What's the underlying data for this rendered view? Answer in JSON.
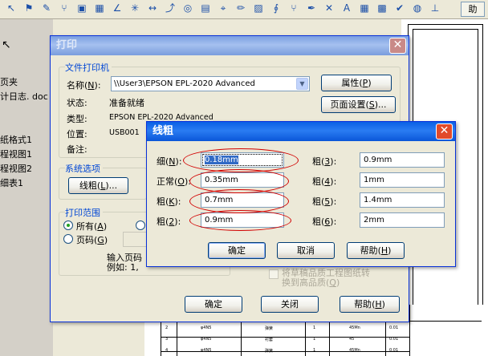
{
  "toolbar": {
    "icons": [
      "arrow-icon",
      "flag-icon",
      "note-icon",
      "fork-icon",
      "box-icon",
      "grid-icon",
      "angle-icon",
      "star-icon",
      "dimension-icon",
      "bend-icon",
      "target-icon",
      "stack-icon",
      "cursor-icon",
      "pencil-icon",
      "hatch-icon",
      "symbol-icon",
      "fork-icon",
      "pen-icon",
      "cross-icon",
      "letter-icon",
      "grid-icon",
      "cell-icon",
      "check-icon",
      "cylinder-icon",
      "pin-icon"
    ],
    "help_label": "助"
  },
  "left_panel": {
    "items": [
      "页夹",
      "计日志. doc",
      "纸格式1",
      "程视图1",
      "程视图2",
      "细表1"
    ]
  },
  "print_dialog": {
    "title": "打印",
    "printer_group": "文件打印机",
    "name_label": "名称",
    "name_key": "N",
    "printer_name": "\\\\User3\\EPSON EPL-2020 Advanced",
    "properties_button": "属性",
    "properties_key": "P",
    "page_setup_button": "页面设置",
    "page_setup_key": "S",
    "status_label": "状态:",
    "status_value": "准备就绪",
    "type_label": "类型:",
    "type_value": "EPSON EPL-2020 Advanced",
    "location_label": "位置:",
    "location_value": "USB001",
    "comment_label": "备注:",
    "system_options_group": "系统选项",
    "line_weight_button": "线粗",
    "line_weight_key": "L",
    "print_range_group": "打印范围",
    "all_label": "所有",
    "all_key": "A",
    "pages_label": "页码",
    "pages_key": "G",
    "pages_hint_line1": "输入页码",
    "pages_hint_line2": "例如: 1,",
    "high_quality_label_line1": "将草稿品质工程图纸转",
    "high_quality_label_line2": "换到高品质",
    "high_quality_key": "Q",
    "ok_button": "确定",
    "close_button": "关闭",
    "help_button": "帮助",
    "help_key": "H"
  },
  "line_dialog": {
    "title": "线粗",
    "rows": [
      {
        "left_label": "细",
        "left_key": "N",
        "left_value": "0.18mm",
        "right_label": "粗",
        "right_key": "3",
        "right_value": "0.9mm"
      },
      {
        "left_label": "正常",
        "left_key": "O",
        "left_value": "0.35mm",
        "right_label": "粗",
        "right_key": "4",
        "right_value": "1mm"
      },
      {
        "left_label": "粗",
        "left_key": "K",
        "left_value": "0.7mm",
        "right_label": "粗",
        "right_key": "5",
        "right_value": "1.4mm"
      },
      {
        "left_label": "粗",
        "left_key": "2",
        "left_value": "0.9mm",
        "right_label": "粗",
        "right_key": "6",
        "right_value": "2mm"
      }
    ],
    "ok_button": "确定",
    "cancel_button": "取消",
    "help_button": "帮助",
    "help_key": "H"
  },
  "title_block": {
    "rows": [
      [
        "2",
        "φ4N5",
        "弹簧",
        "1",
        "45Mn",
        "0.01"
      ],
      [
        "3",
        "φ4N5",
        "衬套",
        "1",
        "45",
        "0.01"
      ],
      [
        "4",
        "φ4N5",
        "弹簧",
        "1",
        "45Mn",
        "0.01"
      ]
    ]
  },
  "colors": {
    "accent": "#0a5fe5",
    "highlight": "#d20000"
  }
}
